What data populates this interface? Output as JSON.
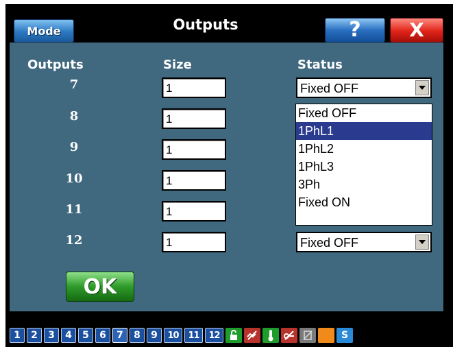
{
  "window": {
    "title": "Outputs",
    "mode_label": "Mode",
    "help_label": "?",
    "close_label": "X"
  },
  "headers": {
    "outputs": "Outputs",
    "size": "Size",
    "status": "Status"
  },
  "rows": [
    {
      "output": "7",
      "size": "1",
      "status": "Fixed OFF"
    },
    {
      "output": "8",
      "size": "1",
      "status": ""
    },
    {
      "output": "9",
      "size": "1",
      "status": ""
    },
    {
      "output": "10",
      "size": "1",
      "status": ""
    },
    {
      "output": "11",
      "size": "1",
      "status": ""
    },
    {
      "output": "12",
      "size": "1",
      "status": "Fixed OFF"
    }
  ],
  "dropdown": {
    "options": [
      "Fixed OFF",
      "1PhL1",
      "1PhL2",
      "1PhL3",
      "3Ph",
      "Fixed ON"
    ],
    "highlighted": "1PhL1"
  },
  "ok_label": "OK",
  "bottom_nav": {
    "numbers": [
      "1",
      "2",
      "3",
      "4",
      "5",
      "6",
      "7",
      "8",
      "9",
      "10",
      "11",
      "12"
    ],
    "icons": [
      {
        "name": "lock-icon",
        "color": "#1e9c2c"
      },
      {
        "name": "phase-slash-icon",
        "color": "#b8332b"
      },
      {
        "name": "thermometer-icon",
        "color": "#1e9c2c"
      },
      {
        "name": "key-slash-icon",
        "color": "#b8332b"
      },
      {
        "name": "disabled-page-icon",
        "color": "#7a7a7a"
      },
      {
        "name": "orange-square-icon",
        "color": "#f08a1a"
      },
      {
        "name": "s-icon",
        "color": "#2a8ad8",
        "label": "S"
      }
    ]
  },
  "colors": {
    "panel": "#40687f",
    "frame": "#000000",
    "highlight": "#2a3b8f"
  }
}
